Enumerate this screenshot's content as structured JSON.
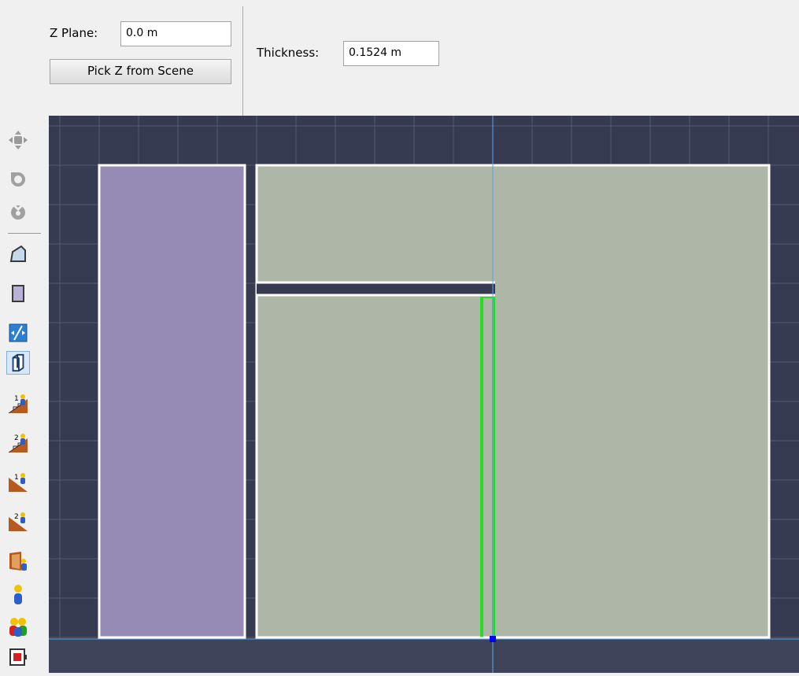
{
  "toolbar": {
    "z_plane_label": "Z Plane:",
    "z_plane_value": "0.0 m",
    "pick_z_button": "Pick Z from Scene",
    "thickness_label": "Thickness:",
    "thickness_value": "0.1524 m"
  },
  "tools": [
    {
      "name": "pan-tool-icon",
      "interactable": true
    },
    {
      "name": "rotate-tool-icon",
      "interactable": true
    },
    {
      "name": "orbit-tool-icon",
      "interactable": true
    },
    {
      "name": "draw-polygon-tool-icon",
      "interactable": true
    },
    {
      "name": "draw-rectangle-tool-icon",
      "interactable": true
    },
    {
      "name": "split-tool-icon",
      "interactable": true
    },
    {
      "name": "extrude-wall-tool-icon",
      "interactable": true,
      "selected": true
    },
    {
      "name": "stairs-1-tool-icon",
      "interactable": true
    },
    {
      "name": "stairs-2-tool-icon",
      "interactable": true
    },
    {
      "name": "ramp-1-tool-icon",
      "interactable": true
    },
    {
      "name": "ramp-2-tool-icon",
      "interactable": true
    },
    {
      "name": "door-tool-icon",
      "interactable": true
    },
    {
      "name": "occupant-tool-icon",
      "interactable": true
    },
    {
      "name": "occupant-group-tool-icon",
      "interactable": true
    },
    {
      "name": "exit-tool-icon",
      "interactable": true
    }
  ],
  "colors": {
    "grid_background": "#363b51",
    "grid_lines": "#4f556c",
    "room_purple": "#968bb5",
    "room_gray": "#aeb6a7",
    "wall_outline": "#ffffff",
    "guide_line": "#5aa6e8",
    "selection_green": "#22dd22",
    "anchor_point": "#0000ff"
  }
}
